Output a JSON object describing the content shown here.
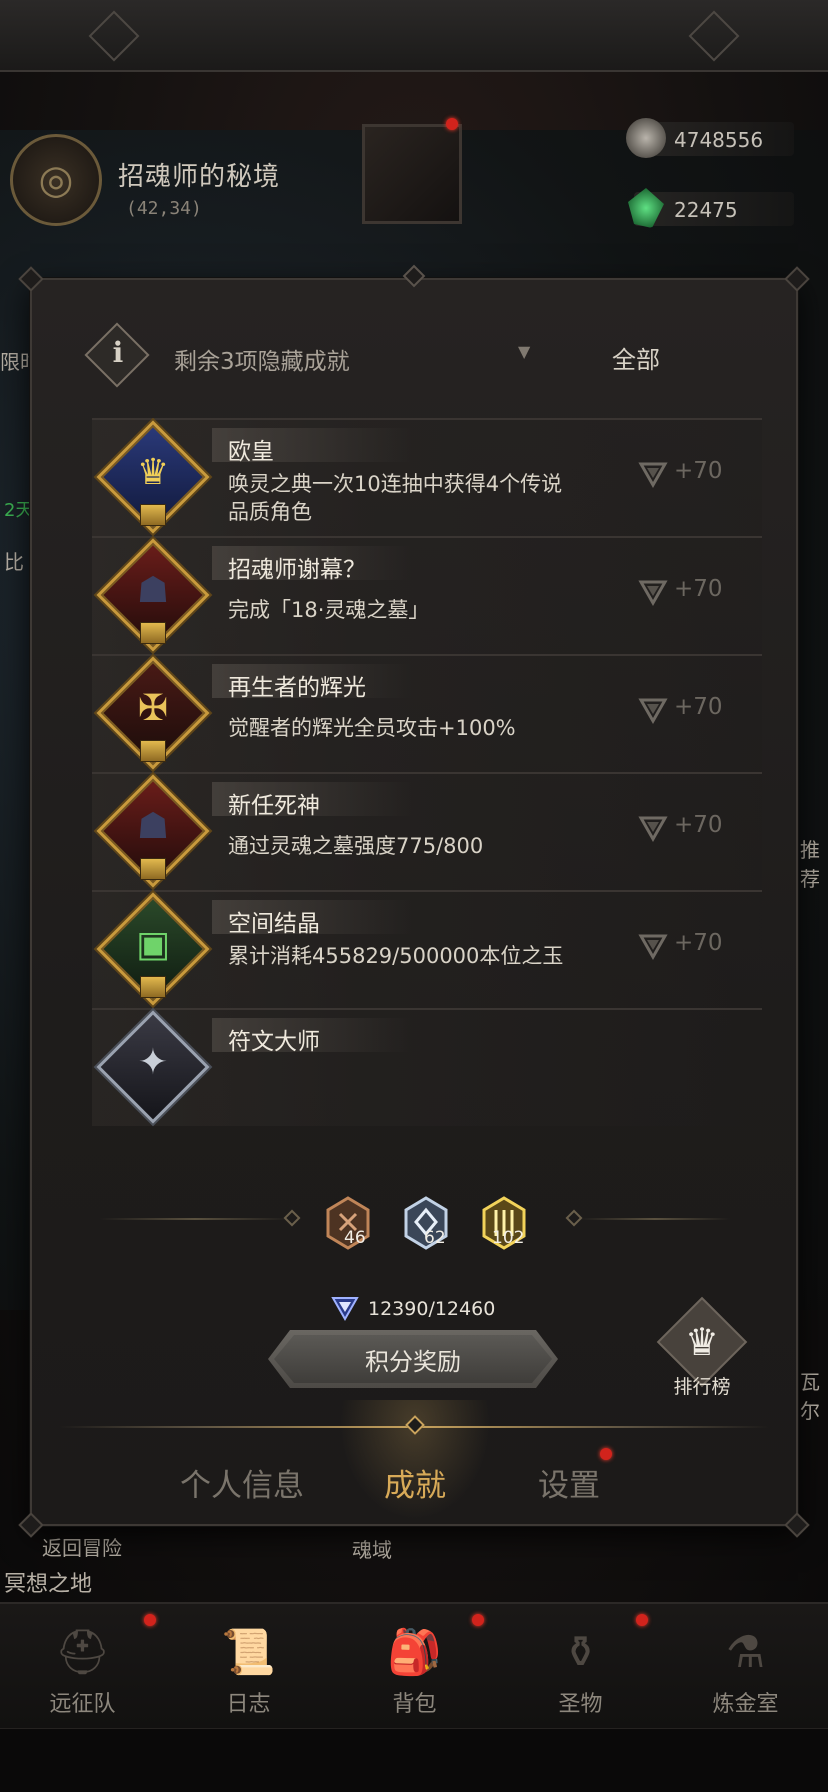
{
  "location": {
    "name": "招魂师的秘境",
    "coords": "(42,34)"
  },
  "currencies": [
    {
      "icon": "soul-stone-icon",
      "value": "4748556"
    },
    {
      "icon": "green-gem-icon",
      "value": "22475"
    }
  ],
  "side_labels": {
    "left_top": "限时",
    "left_green": "2天",
    "left_mid": "比",
    "right_mid": "推荐",
    "right_low": "瓦尔"
  },
  "under_panel": {
    "return_label": "返回冒险",
    "soul_domain_label": "魂域",
    "meditation_label": "冥想之地"
  },
  "filter": {
    "hidden_text": "剩余3项隐藏成就",
    "selected": "全部"
  },
  "achievements": [
    {
      "title": "欧皇",
      "desc": "唤灵之典一次10连抽中获得4个传说品质角色",
      "reward": "+70",
      "icon": "crowned-king-icon"
    },
    {
      "title": "招魂师谢幕？",
      "desc": "完成「18·灵魂之墓」",
      "reward": "+70",
      "icon": "hooded-reaper-icon"
    },
    {
      "title": "再生者的辉光",
      "desc": "觉醒者的辉光全员攻击+100%",
      "reward": "+70",
      "icon": "golden-sword-emblem-icon"
    },
    {
      "title": "新任死神",
      "desc": "通过灵魂之墓强度775/800",
      "reward": "+70",
      "icon": "hooded-reaper-icon"
    },
    {
      "title": "空间结晶",
      "desc": "累计消耗455829/500000本位之玉",
      "reward": "+70",
      "icon": "treasure-chest-icon"
    },
    {
      "title": "符文大师",
      "desc": "",
      "reward": "",
      "icon": "rune-master-icon"
    }
  ],
  "rank_counts": [
    {
      "tier": "bronze",
      "icon": "bronze-trophy-icon",
      "count": "46"
    },
    {
      "tier": "silver",
      "icon": "silver-trophy-icon",
      "count": "62"
    },
    {
      "tier": "gold",
      "icon": "gold-trophy-icon",
      "count": "102"
    }
  ],
  "points": {
    "value": "12390/12460",
    "icon": "achievement-point-icon"
  },
  "claim_button_label": "积分奖励",
  "leaderboard_label": "排行榜",
  "tabs": [
    {
      "label": "个人信息",
      "active": false
    },
    {
      "label": "成就",
      "active": true
    },
    {
      "label": "设置",
      "active": false,
      "badge": true
    }
  ],
  "bottom_nav": [
    {
      "label": "远征队",
      "icon": "viking-helmet-icon",
      "badge": true
    },
    {
      "label": "日志",
      "icon": "scroll-icon",
      "badge": false
    },
    {
      "label": "背包",
      "icon": "backpack-icon",
      "badge": true
    },
    {
      "label": "圣物",
      "icon": "chalice-icon",
      "badge": true
    },
    {
      "label": "炼金室",
      "icon": "alchemy-icon",
      "badge": false
    }
  ],
  "colors": {
    "accent_gold": "#d8aa58",
    "frame_gold": "#c99a3c",
    "notification_red": "#d2231c"
  }
}
